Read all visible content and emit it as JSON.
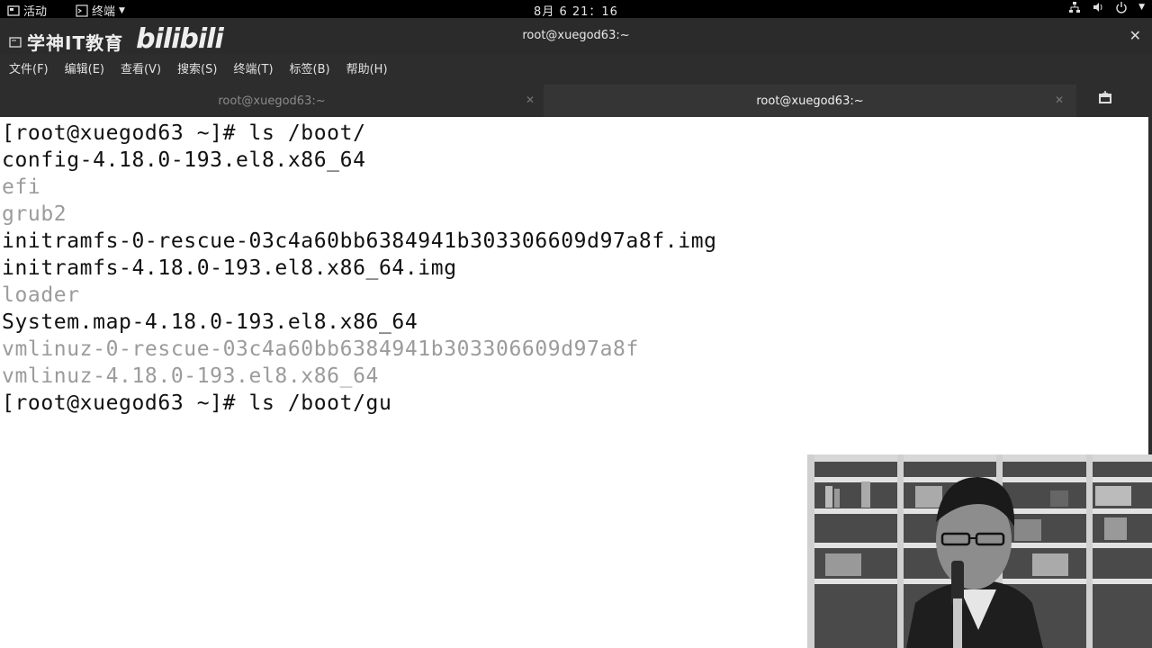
{
  "topbar": {
    "activities": "活动",
    "app_menu": "终端",
    "clock": "8月 6  21：16",
    "tray_icons": [
      "network-icon",
      "volume-icon",
      "power-icon"
    ]
  },
  "window": {
    "brand_text": "学神IT教育",
    "brand_logo": "bilibili",
    "title": "root@xuegod63:~"
  },
  "menu": {
    "items": [
      "文件(F)",
      "编辑(E)",
      "查看(V)",
      "搜索(S)",
      "终端(T)",
      "标签(B)",
      "帮助(H)"
    ]
  },
  "tabs": [
    {
      "label": "root@xuegod63:~",
      "active": false
    },
    {
      "label": "root@xuegod63:~",
      "active": true
    }
  ],
  "terminal": {
    "lines": [
      {
        "text": "[root@xuegod63 ~]# ls /boot/",
        "kind": "prompt"
      },
      {
        "text": "config-4.18.0-193.el8.x86_64",
        "kind": "file"
      },
      {
        "text": "efi",
        "kind": "dir"
      },
      {
        "text": "grub2",
        "kind": "dir"
      },
      {
        "text": "initramfs-0-rescue-03c4a60bb6384941b303306609d97a8f.img",
        "kind": "file"
      },
      {
        "text": "initramfs-4.18.0-193.el8.x86_64.img",
        "kind": "file"
      },
      {
        "text": "loader",
        "kind": "dir"
      },
      {
        "text": "System.map-4.18.0-193.el8.x86_64",
        "kind": "file"
      },
      {
        "text": "vmlinuz-0-rescue-03c4a60bb6384941b303306609d97a8f",
        "kind": "dir"
      },
      {
        "text": "vmlinuz-4.18.0-193.el8.x86_64",
        "kind": "dir"
      },
      {
        "text": "[root@xuegod63 ~]# ls /boot/gu",
        "kind": "prompt"
      }
    ]
  },
  "colors": {
    "terminal_bg": "#ffffff",
    "terminal_fg": "#111111",
    "dim_fg": "#9b9b9b",
    "chrome_bg": "#2d2d2d"
  }
}
